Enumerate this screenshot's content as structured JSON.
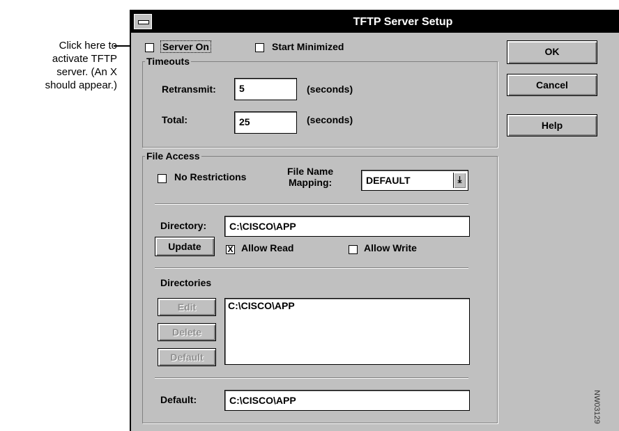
{
  "callout": {
    "lines": [
      "Click here to",
      "activate TFTP",
      "server. (An X",
      "should appear.)"
    ]
  },
  "window": {
    "title": "TFTP Server Setup"
  },
  "options": {
    "server_on": {
      "label": "Server On",
      "checked": false
    },
    "start_minimized": {
      "label": "Start Minimized",
      "checked": false
    }
  },
  "timeouts": {
    "group_label": "Timeouts",
    "retransmit": {
      "label": "Retransmit:",
      "value": "5",
      "unit": "(seconds)"
    },
    "total": {
      "label": "Total:",
      "value": "25",
      "unit": "(seconds)"
    }
  },
  "file_access": {
    "group_label": "File Access",
    "no_restrictions": {
      "label": "No Restrictions",
      "checked": false
    },
    "mapping_label_1": "File Name",
    "mapping_label_2": "Mapping:",
    "mapping_value": "DEFAULT",
    "directory_label": "Directory:",
    "directory_value": "C:\\CISCO\\APP",
    "update_label": "Update",
    "allow_read": {
      "label": "Allow Read",
      "checked": true,
      "mark": "X"
    },
    "allow_write": {
      "label": "Allow Write",
      "checked": false
    },
    "directories_label": "Directories",
    "edit_label": "Edit",
    "delete_label": "Delete",
    "default_btn_label": "Default",
    "directories_list": [
      "C:\\CISCO\\APP"
    ],
    "default_label": "Default:",
    "default_value": "C:\\CISCO\\APP"
  },
  "buttons": {
    "ok": "OK",
    "cancel": "Cancel",
    "help": "Help"
  },
  "figure_code": "NW03129",
  "icons": {
    "dropdown": "chevron-down-icon",
    "system_menu": "system-menu-icon"
  }
}
